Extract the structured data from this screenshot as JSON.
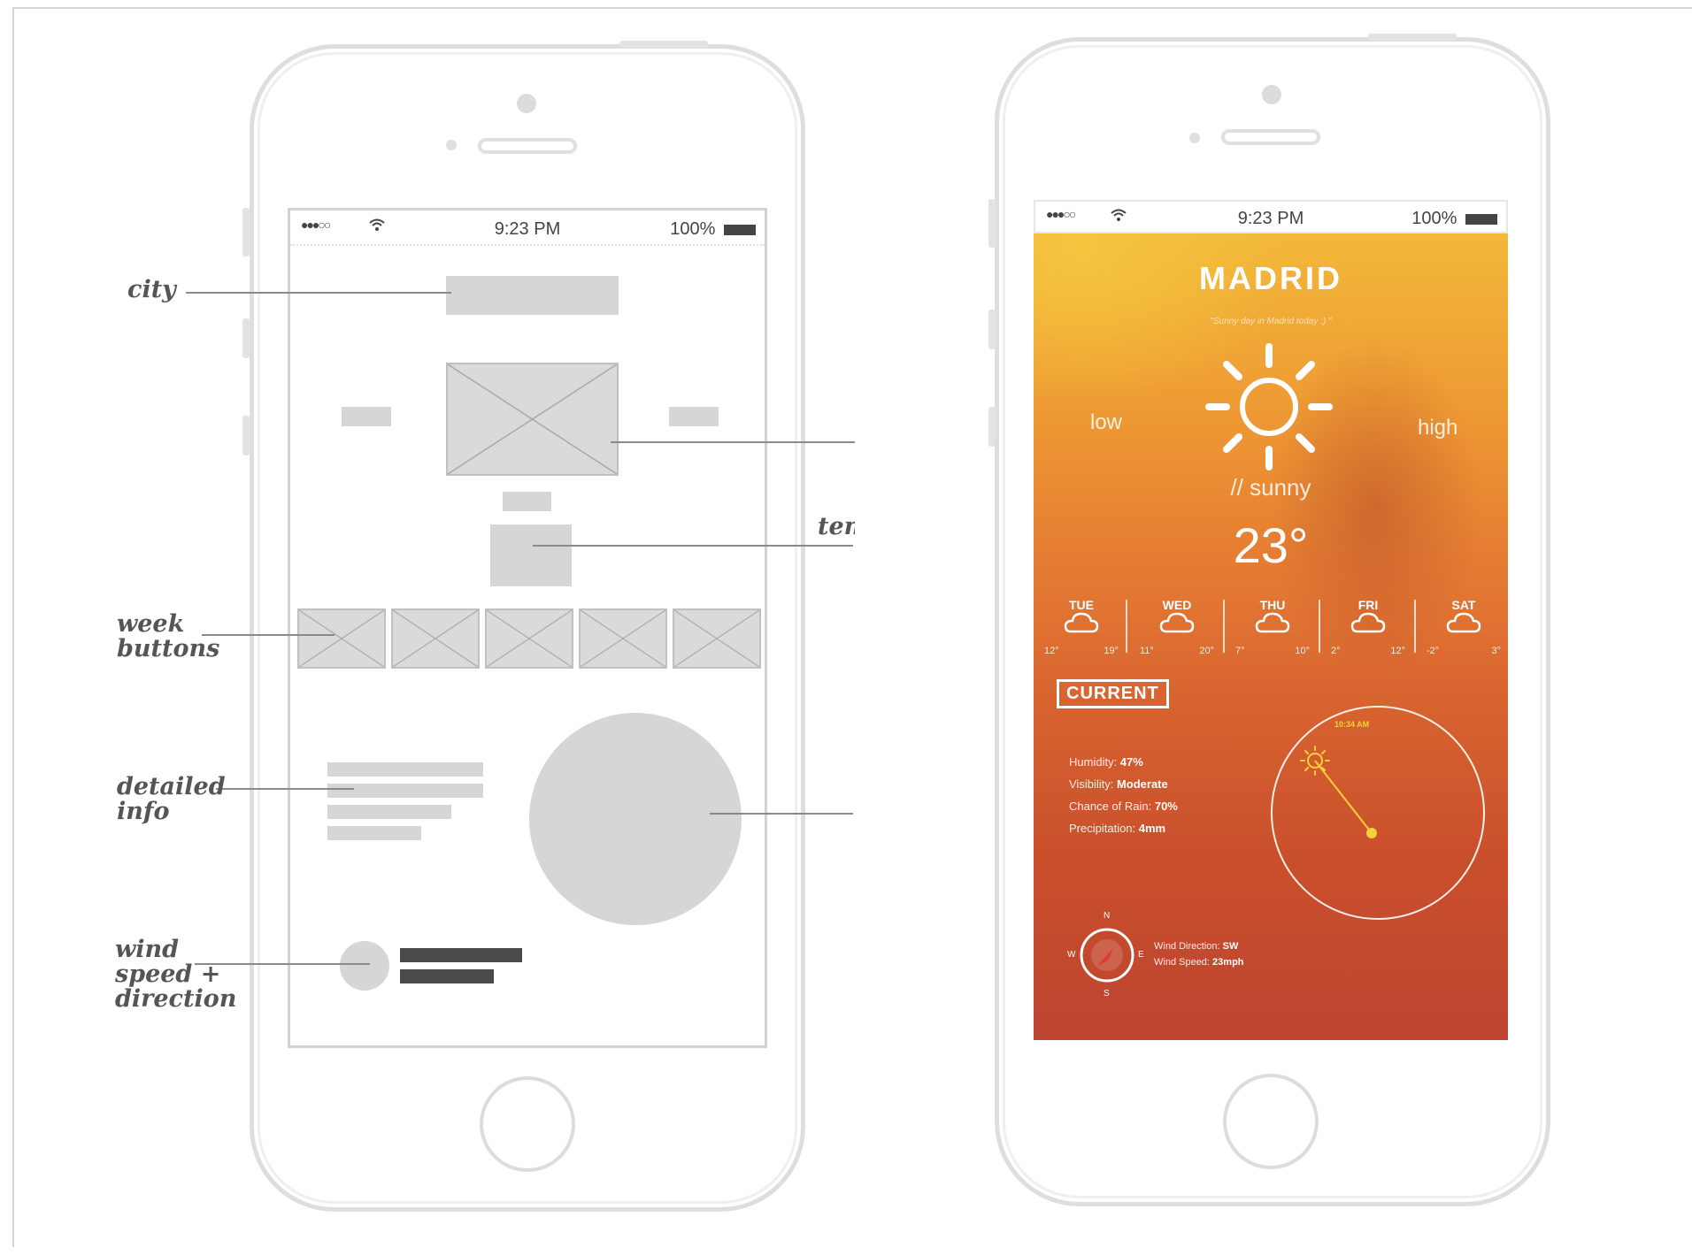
{
  "status_bar": {
    "signal": "●●●○○",
    "time": "9:23 PM",
    "battery": "100%"
  },
  "wireframe": {
    "annotations": {
      "city": "city",
      "temp": "tem",
      "week_buttons_line1": "week",
      "week_buttons_line2": "buttons",
      "detailed_info_line1": "detailed",
      "detailed_info_line2": "info",
      "wind_line1": "wind",
      "wind_line2": "speed +",
      "wind_line3": "direction"
    }
  },
  "weather": {
    "city": "MADRID",
    "tagline": "\"Sunny day in Madrid today :) \"",
    "low_label": "low",
    "high_label": "high",
    "condition": "// sunny",
    "temperature": "23°",
    "forecast": [
      {
        "day": "TUE",
        "low": "12°",
        "high": "19°"
      },
      {
        "day": "WED",
        "low": "11°",
        "high": "20°"
      },
      {
        "day": "THU",
        "low": "7°",
        "high": "10°"
      },
      {
        "day": "FRI",
        "low": "2°",
        "high": "12°"
      },
      {
        "day": "SAT",
        "low": "-2°",
        "high": "3°"
      }
    ],
    "current_label": "CURRENT",
    "details": [
      {
        "label": "Humidity: ",
        "value": "47%"
      },
      {
        "label": "Visibility: ",
        "value": "Moderate"
      },
      {
        "label": "Chance of Rain: ",
        "value": "70%"
      },
      {
        "label": "Precipitation: ",
        "value": "4mm"
      }
    ],
    "sun_time": "10:34 AM",
    "wind": {
      "direction_label": "Wind Direction: ",
      "direction_value": "SW",
      "speed_label": "Wind Speed: ",
      "speed_value": "23mph",
      "compass": {
        "n": "N",
        "e": "E",
        "s": "S",
        "w": "W"
      }
    },
    "colors": {
      "accent_yellow": "#f5d23a",
      "wind_red": "#e03a2a"
    }
  }
}
